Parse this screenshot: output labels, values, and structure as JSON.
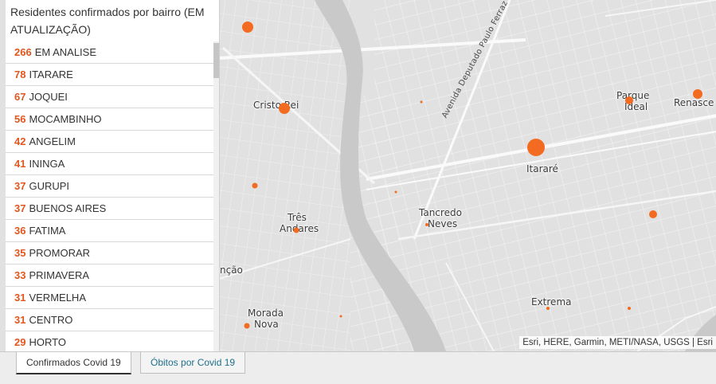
{
  "panel": {
    "title": "Residentes confirmados por bairro (EM ATUALIZAÇÃO)",
    "rows": [
      {
        "count": "266",
        "name": "EM ANALISE"
      },
      {
        "count": "78",
        "name": "ITARARE"
      },
      {
        "count": "67",
        "name": "JOQUEI"
      },
      {
        "count": "56",
        "name": "MOCAMBINHO"
      },
      {
        "count": "42",
        "name": "ANGELIM"
      },
      {
        "count": "41",
        "name": "ININGA"
      },
      {
        "count": "37",
        "name": "GURUPI"
      },
      {
        "count": "37",
        "name": "BUENOS AIRES"
      },
      {
        "count": "36",
        "name": "FATIMA"
      },
      {
        "count": "35",
        "name": "PROMORAR"
      },
      {
        "count": "33",
        "name": "PRIMAVERA"
      },
      {
        "count": "31",
        "name": "VERMELHA"
      },
      {
        "count": "31",
        "name": "CENTRO"
      },
      {
        "count": "29",
        "name": "HORTO"
      }
    ]
  },
  "map": {
    "labels": {
      "cristo_rei": "Cristo Rei",
      "parque_ideal_1": "Parque",
      "parque_ideal_2": "Ideal",
      "renascenca": "Renasce",
      "itarare": "Itararé",
      "tres_andares_1": "Três",
      "tres_andares_2": "Andares",
      "tancredo_neves_1": "Tancredo",
      "tancredo_neves_2": "Neves",
      "extrema": "Extrema",
      "morada_nova_1": "Morada",
      "morada_nova_2": "Nova",
      "concao": "nção",
      "road": "Avenida Deputado Paulo Ferraz"
    },
    "attribution": "Esri, HERE, Garmin, METI/NASA, USGS | Esri",
    "point_color": "#f26b21"
  },
  "tabs": {
    "confirmados": "Confirmados Covid 19",
    "obitos": "Óbitos por Covid 19"
  }
}
